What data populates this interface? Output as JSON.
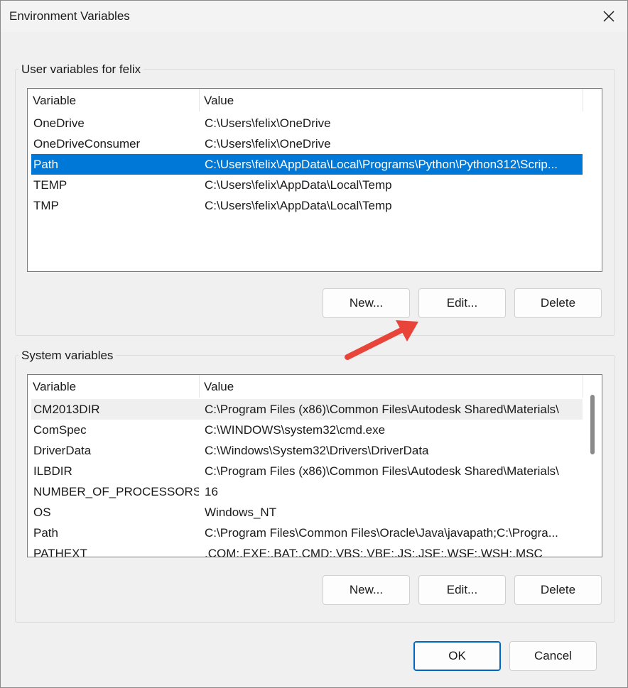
{
  "window": {
    "title": "Environment Variables"
  },
  "user_vars": {
    "group_label": "User variables for felix",
    "columns": [
      "Variable",
      "Value"
    ],
    "rows": [
      {
        "variable": "OneDrive",
        "value": "C:\\Users\\felix\\OneDrive"
      },
      {
        "variable": "OneDriveConsumer",
        "value": "C:\\Users\\felix\\OneDrive"
      },
      {
        "variable": "Path",
        "value": "C:\\Users\\felix\\AppData\\Local\\Programs\\Python\\Python312\\Scrip..."
      },
      {
        "variable": "TEMP",
        "value": "C:\\Users\\felix\\AppData\\Local\\Temp"
      },
      {
        "variable": "TMP",
        "value": "C:\\Users\\felix\\AppData\\Local\\Temp"
      }
    ],
    "selected_row": "Path",
    "buttons": {
      "new": "New...",
      "edit": "Edit...",
      "delete": "Delete"
    }
  },
  "system_vars": {
    "group_label": "System variables",
    "columns": [
      "Variable",
      "Value"
    ],
    "rows": [
      {
        "variable": "CM2013DIR",
        "value": "C:\\Program Files (x86)\\Common Files\\Autodesk Shared\\Materials\\"
      },
      {
        "variable": "ComSpec",
        "value": "C:\\WINDOWS\\system32\\cmd.exe"
      },
      {
        "variable": "DriverData",
        "value": "C:\\Windows\\System32\\Drivers\\DriverData"
      },
      {
        "variable": "ILBDIR",
        "value": "C:\\Program Files (x86)\\Common Files\\Autodesk Shared\\Materials\\"
      },
      {
        "variable": "NUMBER_OF_PROCESSORS",
        "value": "16"
      },
      {
        "variable": "OS",
        "value": "Windows_NT"
      },
      {
        "variable": "Path",
        "value": "C:\\Program Files\\Common Files\\Oracle\\Java\\javapath;C:\\Progra..."
      },
      {
        "variable": "PATHEXT",
        "value": ".COM;.EXE;.BAT;.CMD;.VBS;.VBE;.JS;.JSE;.WSF;.WSH;.MSC"
      }
    ],
    "buttons": {
      "new": "New...",
      "edit": "Edit...",
      "delete": "Delete"
    }
  },
  "footer": {
    "ok": "OK",
    "cancel": "Cancel"
  },
  "colors": {
    "selection": "#0078d7",
    "annotation_arrow": "#e8443a",
    "primary_border": "#0067c0"
  }
}
